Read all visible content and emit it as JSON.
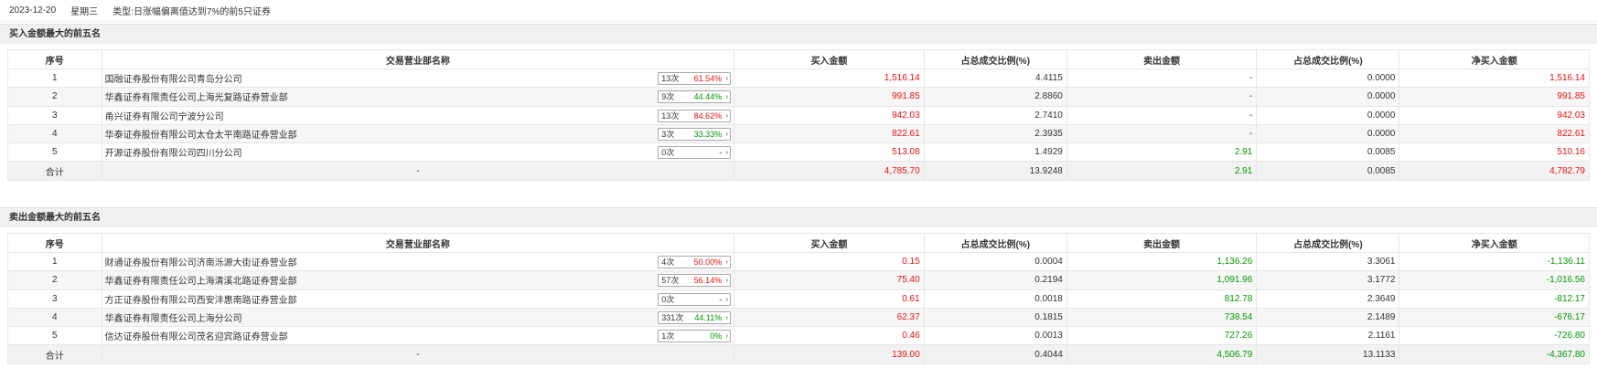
{
  "topbar": {
    "date": "2023-12-20",
    "weekday": "星期三",
    "type_label": "类型:",
    "type_value": "日涨幅偏离值达到7%的前5只证券"
  },
  "buy_section": {
    "title": "买入金额最大的前五名",
    "headers": [
      "序号",
      "交易营业部名称",
      "买入金额",
      "占总成交比例(%)",
      "卖出金额",
      "占总成交比例(%)",
      "净买入金额"
    ],
    "rows": [
      {
        "seq": "1",
        "name": "国融证券股份有限公司青岛分公司",
        "count": "13次",
        "rate": "61.54%",
        "rate_color": "red",
        "buy": "1,516.14",
        "buy_pct": "4.4115",
        "sell": "-",
        "sell_pct": "0.0000",
        "net": "1,516.14",
        "net_color": "red"
      },
      {
        "seq": "2",
        "name": "华鑫证券有限责任公司上海光复路证券营业部",
        "count": "9次",
        "rate": "44.44%",
        "rate_color": "green",
        "buy": "991.85",
        "buy_pct": "2.8860",
        "sell": "-",
        "sell_pct": "0.0000",
        "net": "991.85",
        "net_color": "red"
      },
      {
        "seq": "3",
        "name": "甬兴证券有限公司宁波分公司",
        "count": "13次",
        "rate": "84.62%",
        "rate_color": "red",
        "buy": "942.03",
        "buy_pct": "2.7410",
        "sell": "-",
        "sell_pct": "0.0000",
        "net": "942.03",
        "net_color": "red"
      },
      {
        "seq": "4",
        "name": "华泰证券股份有限公司太仓太平南路证券营业部",
        "count": "3次",
        "rate": "33.33%",
        "rate_color": "green",
        "buy": "822.61",
        "buy_pct": "2.3935",
        "sell": "-",
        "sell_pct": "0.0000",
        "net": "822.61",
        "net_color": "red"
      },
      {
        "seq": "5",
        "name": "开源证券股份有限公司四川分公司",
        "count": "0次",
        "rate": "-",
        "rate_color": "plain",
        "buy": "513.08",
        "buy_pct": "1.4929",
        "sell": "2.91",
        "sell_pct": "0.0085",
        "net": "510.16",
        "net_color": "red"
      }
    ],
    "total": {
      "label": "合计",
      "name": "-",
      "buy": "4,785.70",
      "buy_pct": "13.9248",
      "sell": "2.91",
      "sell_pct": "0.0085",
      "net": "4,782.79",
      "net_color": "red"
    }
  },
  "sell_section": {
    "title": "卖出金额最大的前五名",
    "headers": [
      "序号",
      "交易营业部名称",
      "买入金额",
      "占总成交比例(%)",
      "卖出金额",
      "占总成交比例(%)",
      "净买入金额"
    ],
    "rows": [
      {
        "seq": "1",
        "name": "财通证券股份有限公司济南泺源大街证券营业部",
        "count": "4次",
        "rate": "50.00%",
        "rate_color": "red",
        "buy": "0.15",
        "buy_pct": "0.0004",
        "sell": "1,136.26",
        "sell_pct": "3.3061",
        "net": "-1,136.11",
        "net_color": "green"
      },
      {
        "seq": "2",
        "name": "华鑫证券有限责任公司上海清溪北路证券营业部",
        "count": "57次",
        "rate": "56.14%",
        "rate_color": "red",
        "buy": "75.40",
        "buy_pct": "0.2194",
        "sell": "1,091.96",
        "sell_pct": "3.1772",
        "net": "-1,016.56",
        "net_color": "green"
      },
      {
        "seq": "3",
        "name": "方正证券股份有限公司西安沣惠南路证券营业部",
        "count": "0次",
        "rate": "-",
        "rate_color": "plain",
        "buy": "0.61",
        "buy_pct": "0.0018",
        "sell": "812.78",
        "sell_pct": "2.3649",
        "net": "-812.17",
        "net_color": "green"
      },
      {
        "seq": "4",
        "name": "华鑫证券有限责任公司上海分公司",
        "count": "331次",
        "rate": "44.11%",
        "rate_color": "green",
        "buy": "62.37",
        "buy_pct": "0.1815",
        "sell": "738.54",
        "sell_pct": "2.1489",
        "net": "-676.17",
        "net_color": "green"
      },
      {
        "seq": "5",
        "name": "信达证券股份有限公司茂名迎宾路证券营业部",
        "count": "1次",
        "rate": "0%",
        "rate_color": "green",
        "buy": "0.46",
        "buy_pct": "0.0013",
        "sell": "727.26",
        "sell_pct": "2.1161",
        "net": "-726.80",
        "net_color": "green"
      }
    ],
    "total": {
      "label": "合计",
      "name": "-",
      "buy": "139.00",
      "buy_pct": "0.4044",
      "sell": "4,506.79",
      "sell_pct": "13.1133",
      "net": "-4,367.80",
      "net_color": "green"
    }
  },
  "colors": {
    "up": "#ee1111",
    "down": "#009900",
    "header_bg": "#f0f0f0"
  },
  "icons": {
    "badge_arrow": "chevron-right-icon"
  }
}
